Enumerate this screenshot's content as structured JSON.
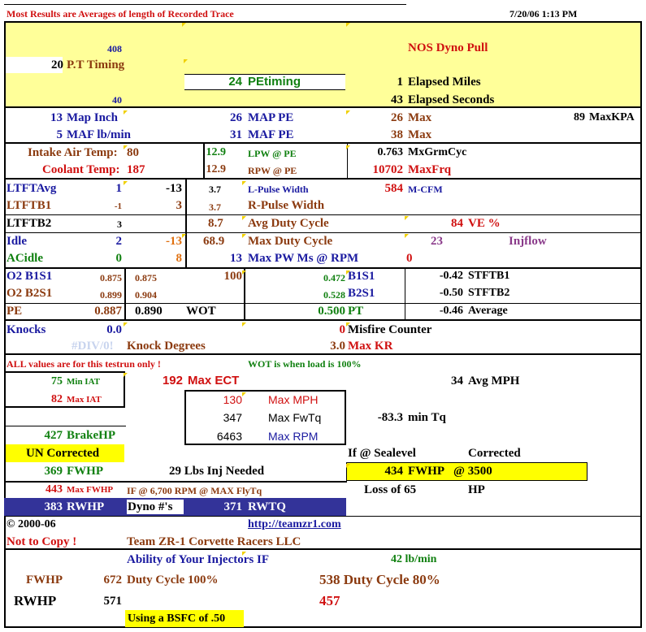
{
  "header": {
    "note": "Most Results are Averages of length of Recorded Trace",
    "datetime": "7/20/06 1:13 PM"
  },
  "top": {
    "n408": "408",
    "pt_value": "20",
    "pt_label": "P.T Timing",
    "title": "NOS Dyno Pull",
    "pe_timing_value": "24",
    "pe_timing_label": "PEtiming",
    "elapsed_miles_value": "1",
    "elapsed_miles_label": "Elapsed Miles",
    "n40": "40",
    "elapsed_seconds_value": "43",
    "elapsed_seconds_label": "Elapsed Seconds"
  },
  "map": {
    "map_inch_value": "13",
    "map_inch_label": "Map Inch",
    "map_pe_value": "26",
    "map_pe_label": "MAP PE",
    "map_max_value": "26",
    "map_max_label": "Max",
    "maxkpa_value": "89",
    "maxkpa_label": "MaxKPA",
    "maf_value": "5",
    "maf_label": "MAF lb/min",
    "maf_pe_value": "31",
    "maf_pe_label": "MAF PE",
    "maf_max_value": "38",
    "maf_max_label": "Max"
  },
  "temps": {
    "iat_label": "Intake Air Temp:",
    "iat_value": "80",
    "lpw_value": "12.9",
    "lpw_label": "LPW @ PE",
    "mxgrm_value": "0.763",
    "mxgrm_label": "MxGrmCyc",
    "coolant_label": "Coolant Temp:",
    "coolant_value": "187",
    "rpw_value": "12.9",
    "rpw_label": "RPW @ PE",
    "maxfrq_value": "10702",
    "maxfrq_label": "MaxFrq"
  },
  "trims": {
    "ltftavg_label": "LTFTAvg",
    "ltftavg_a": "1",
    "ltftavg_b": "-13",
    "lpulse_value": "3.7",
    "lpulse_label": "L-Pulse Width",
    "mcfm_value": "584",
    "mcfm_label": "M-CFM",
    "ltftb1_label": "LTFTB1",
    "ltftb1_a": "-1",
    "ltftb1_b": "3",
    "rpulse_value": "3.7",
    "rpulse_label": "R-Pulse Width",
    "ltftb2_label": "LTFTB2",
    "ltftb2_a": "3",
    "avgduty_value": "8.7",
    "avgduty_label": "Avg Duty Cycle",
    "ve_value": "84",
    "ve_label": "VE %",
    "idle_label": "Idle",
    "idle_a": "2",
    "idle_b": "-13",
    "maxduty_value": "68.9",
    "maxduty_label": "Max Duty Cycle",
    "injflow_value": "23",
    "injflow_label": "Injflow",
    "acidle_label": "ACidle",
    "acidle_a": "0",
    "acidle_b": "8",
    "maxpw_value": "13",
    "maxpw_label": "Max PW Ms @ RPM",
    "maxpw_rpm": "0"
  },
  "o2": {
    "b1s1_label": "O2 B1S1",
    "b1s1_a": "0.875",
    "b1s1_b": "0.875",
    "b1s1_c": "100",
    "b1s1_r_value": "0.472",
    "b1s1_r_label": "B1S1",
    "stftb1_value": "-0.42",
    "stftb1_label": "STFTB1",
    "b2s1_label": "O2 B2S1",
    "b2s1_a": "0.899",
    "b2s1_b": "0.904",
    "b2s1_r_value": "0.528",
    "b2s1_r_label": "B2S1",
    "stftb2_value": "-0.50",
    "stftb2_label": "STFTB2",
    "pe_label": "PE",
    "pe_value": "0.887",
    "wot_value": "0.890",
    "wot_label": "WOT",
    "pt_value": "0.500",
    "pt_label": "PT",
    "avg_value": "-0.46",
    "avg_label": "Average"
  },
  "knock": {
    "knocks_label": "Knocks",
    "knocks_value": "0.0",
    "misfire_value": "0",
    "misfire_label": "Misfire Counter",
    "div0": "#DIV/0!",
    "degrees_label": "Knock  Degrees",
    "maxkr_value": "3.0",
    "maxkr_label": "Max KR"
  },
  "notes": {
    "all_values": "ALL values are for this testrun only !",
    "wot_note": "WOT is when load is 100%"
  },
  "peaks": {
    "min_iat_value": "75",
    "min_iat_label": "Min IAT",
    "max_ect_value": "192",
    "max_ect_label": "Max ECT",
    "avg_mph_value": "34",
    "avg_mph_label": "Avg MPH",
    "max_iat_value": "82",
    "max_iat_label": "Max IAT",
    "max_mph_value": "130",
    "max_mph_label": "Max MPH",
    "max_fwtq_value": "347",
    "max_fwtq_label": "Max FwTq",
    "min_tq_value": "-83.3",
    "min_tq_label": "min Tq",
    "max_rpm_value": "6463",
    "max_rpm_label": "Max RPM"
  },
  "power": {
    "brakehp_value": "427",
    "brakehp_label": "BrakeHP",
    "uncorrected": "UN Corrected",
    "sealevel_label": "If @ Sealevel",
    "corrected_label": "Corrected",
    "fwhp_value": "369",
    "fwhp_label": "FWHP",
    "inj_needed": "29 Lbs Inj Needed",
    "corr_fwhp_value": "434",
    "corr_fwhp_label": "FWHP",
    "corr_rpm": "@ 3500",
    "max_fwhp_value": "443",
    "max_fwhp_label": "Max FWHP",
    "flytq_note": "IF @ 6,700 RPM @ MAX FlyTq",
    "loss_label": "Loss of 65",
    "loss_unit": "HP",
    "rwhp_value": "383",
    "rwhp_label": "RWHP",
    "dyno_label": "Dyno #'s",
    "rwtq_value": "371",
    "rwtq_label": "RWTQ"
  },
  "footer": {
    "copyright": "© 2000-06",
    "link": "http://teamzr1.com",
    "not_copy": "Not to Copy !",
    "company": "Team ZR-1 Corvette Racers LLC",
    "ability": "Ability of Your Injectors IF",
    "lbmin": "42 lb/min",
    "fwhp_label": "FWHP",
    "fwhp_100_value": "672",
    "duty100_label": "Duty Cycle 100%",
    "duty80": "538 Duty Cycle 80%",
    "rwhp_label": "RWHP",
    "rwhp_100_value": "571",
    "rwhp_80_value": "457",
    "bsfc": "Using a BSFC of .50"
  },
  "colors": {
    "yellow": "#ffff99",
    "bright_yellow": "#ffff00",
    "navy": "#333399"
  }
}
